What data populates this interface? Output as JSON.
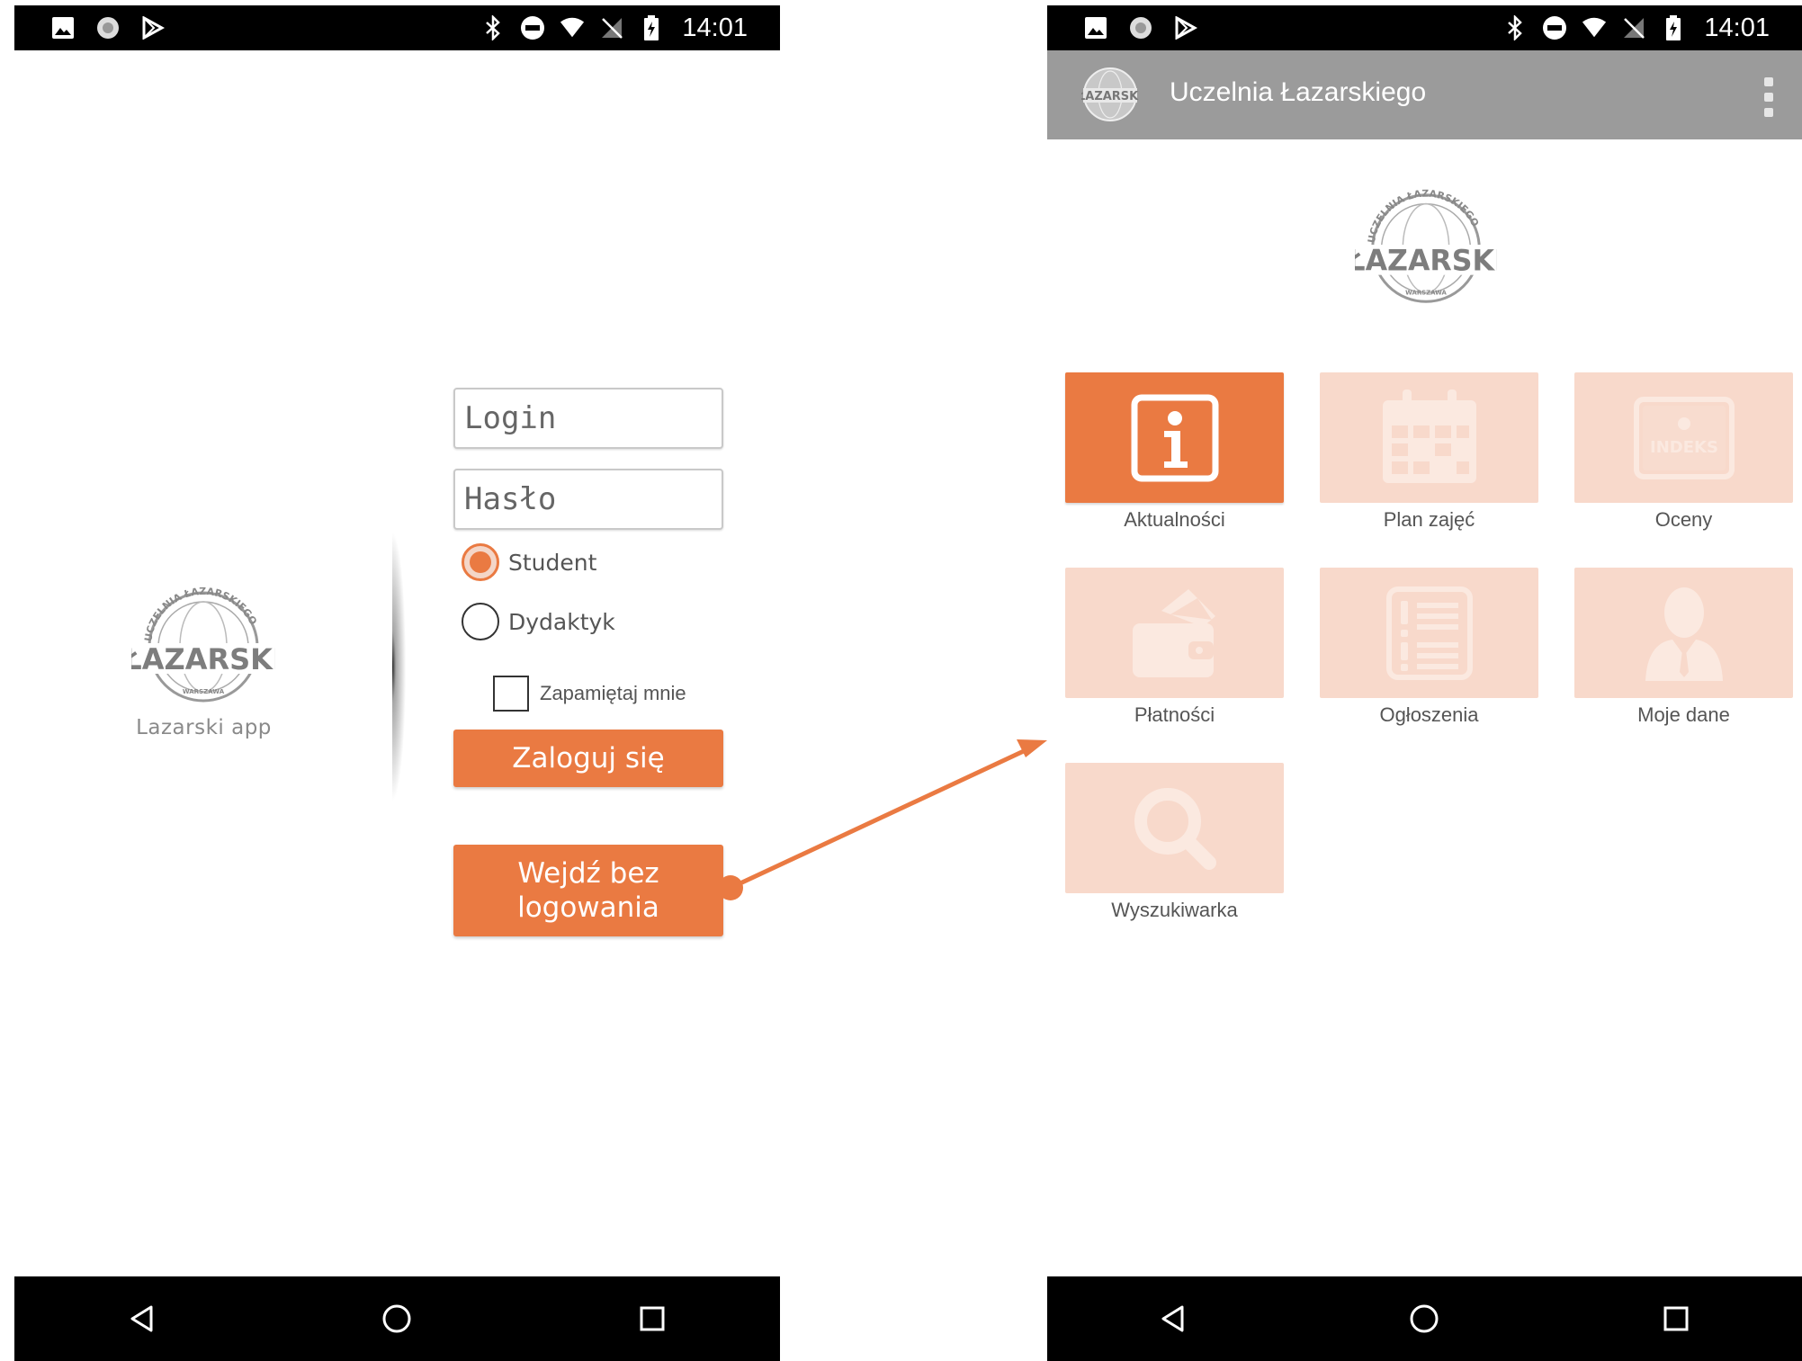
{
  "status_bar": {
    "time": "14:01"
  },
  "login_screen": {
    "splash_caption": "Lazarski app",
    "login_placeholder": "Login",
    "password_placeholder": "Hasło",
    "role_student": "Student",
    "role_lecturer": "Dydaktyk",
    "remember_me": "Zapamiętaj mnie",
    "login_button": "Zaloguj się",
    "guest_button": "Wejdź bez logowania"
  },
  "home_screen": {
    "title": "Uczelnia Łazarskiego",
    "tiles": [
      {
        "label": "Aktualności",
        "icon": "info-icon",
        "active": true
      },
      {
        "label": "Plan zajęć",
        "icon": "calendar-icon",
        "active": false
      },
      {
        "label": "Oceny",
        "icon": "indeks-icon",
        "icon_text": "INDEKS",
        "active": false
      },
      {
        "label": "Płatności",
        "icon": "wallet-icon",
        "active": false
      },
      {
        "label": "Ogłoszenia",
        "icon": "list-icon",
        "active": false
      },
      {
        "label": "Moje dane",
        "icon": "person-icon",
        "active": false
      },
      {
        "label": "Wyszukiwarka",
        "icon": "search-icon",
        "active": false
      }
    ]
  },
  "logo": {
    "arc_text": "UCZELNIA ŁAZARSKIEGO",
    "name": "ŁAZARSKI",
    "city": "WARSZAWA"
  },
  "colors": {
    "accent": "#ea7a42",
    "accent_light": "#f8d9cb",
    "appbar": "#9b9b9b",
    "system_bar": "#000000"
  }
}
